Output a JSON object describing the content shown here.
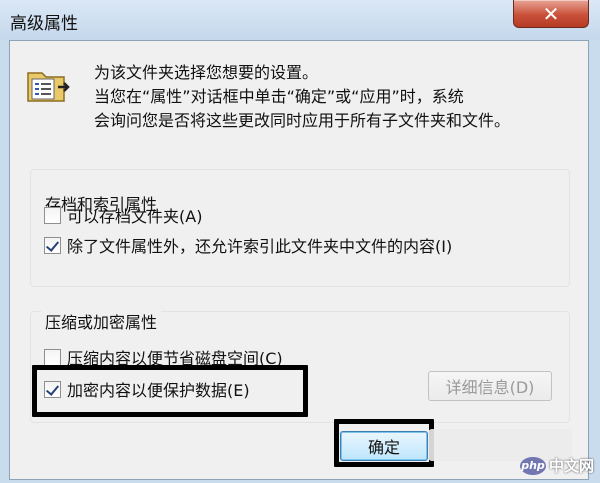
{
  "window": {
    "title": "高级属性",
    "close_glyph": "✕"
  },
  "intro": {
    "line1": "为该文件夹选择您想要的设置。",
    "line2": "当您在“属性”对话框中单击“确定”或“应用”时，系统",
    "line3": "会询问您是否将这些更改同时应用于所有子文件夹和文件。"
  },
  "archive_group": {
    "title": "存档和索引属性",
    "items": [
      {
        "label": "可以存档文件夹(A)",
        "checked": false
      },
      {
        "label": "除了文件属性外，还允许索引此文件夹中文件的内容(I)",
        "checked": true
      }
    ]
  },
  "compress_group": {
    "title": "压缩或加密属性",
    "items": [
      {
        "label": "压缩内容以便节省磁盘空间(C)",
        "checked": false
      },
      {
        "label": "加密内容以便保护数据(E)",
        "checked": true
      }
    ],
    "details_label": "详细信息(D)"
  },
  "footer": {
    "ok_label": "确定"
  },
  "watermark": {
    "logo": "php",
    "text": "中文网"
  },
  "colors": {
    "highlight": "#000000",
    "close_button": "#c9513a",
    "checkmark": "#24427a"
  }
}
